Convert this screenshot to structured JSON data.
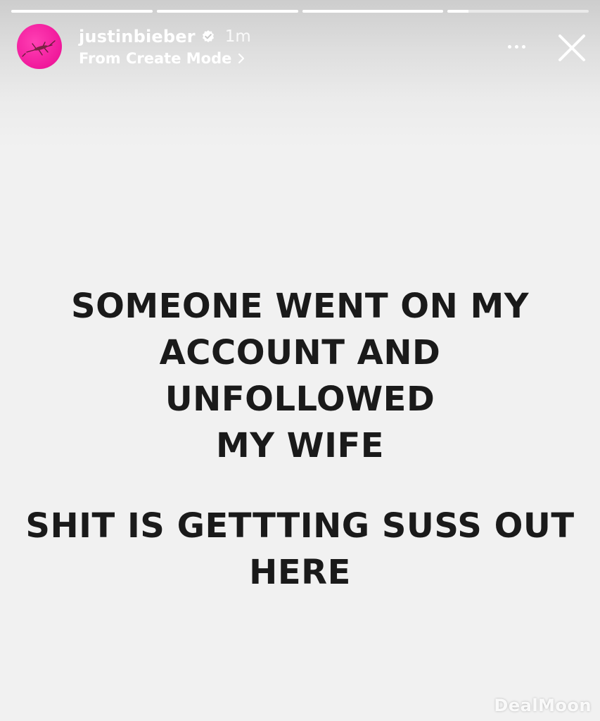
{
  "story": {
    "background": "#f1f1f1",
    "progress": [
      1,
      1,
      1,
      0.15
    ],
    "username": "justinbieber",
    "verified_icon": "verified-badge-icon",
    "time_ago": "1m",
    "subtitle": "From Create Mode",
    "subtitle_icon": "chevron-right-icon",
    "more_icon": "more-horizontal-icon",
    "close_icon": "close-icon"
  },
  "message": {
    "paragraph1": "SOMEONE WENT ON MY\nACCOUNT AND UNFOLLOWED\nMY WIFE",
    "paragraph2": "SHIT IS GETTTING SUSS OUT\nHERE"
  },
  "watermark": {
    "text": "DealMoon"
  }
}
